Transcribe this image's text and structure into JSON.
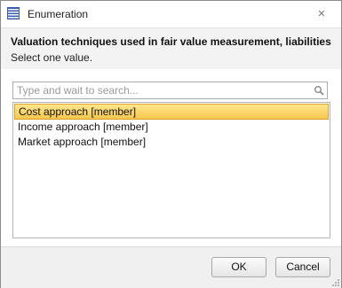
{
  "window": {
    "title": "Enumeration",
    "icon": "list-icon",
    "close_glyph": "✕"
  },
  "header": {
    "title": "Valuation techniques used in fair value measurement, liabilities",
    "subtitle": "Select one value."
  },
  "search": {
    "placeholder": "Type and wait to search...",
    "value": "",
    "icon": "search-icon"
  },
  "list": {
    "selected_index": 0,
    "items": [
      {
        "label": "Cost approach [member]"
      },
      {
        "label": "Income approach [member]"
      },
      {
        "label": "Market approach [member]"
      }
    ]
  },
  "buttons": {
    "ok_label": "OK",
    "cancel_label": "Cancel"
  },
  "colors": {
    "selection": "#f7c74d",
    "selection_border": "#d9a22a",
    "title_icon": "#3b5ea8"
  }
}
